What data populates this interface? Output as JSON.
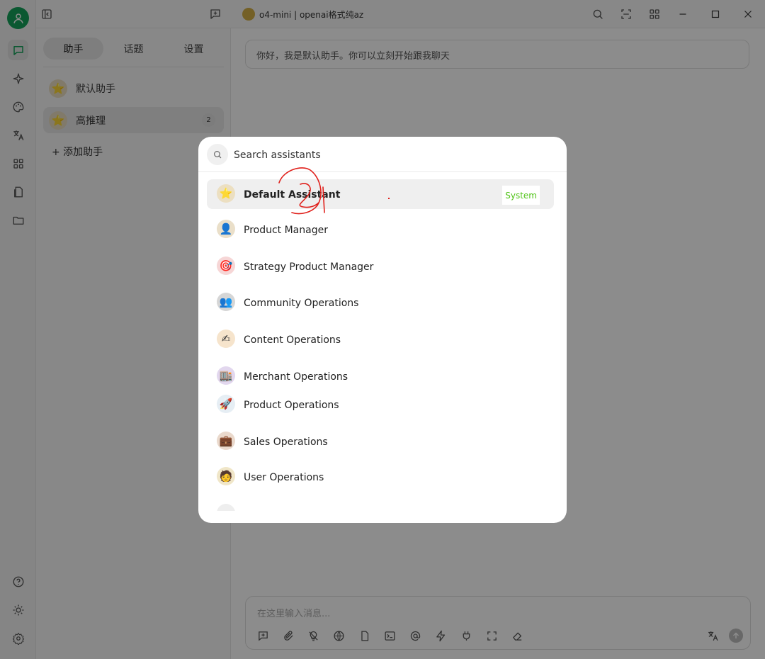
{
  "header": {
    "model_title": "o4-mini | openai格式纯az"
  },
  "sidebar": {
    "tabs": [
      {
        "label": "助手",
        "active": true
      },
      {
        "label": "话题",
        "active": false
      },
      {
        "label": "设置",
        "active": false
      }
    ],
    "assistants": [
      {
        "label": "默认助手",
        "icon": "star-icon"
      },
      {
        "label": "高推理",
        "icon": "star-icon",
        "count": "2",
        "active": true
      }
    ],
    "add_label": "+ 添加助手"
  },
  "chat": {
    "greeting": "你好，我是默认助手。你可以立刻开始跟我聊天",
    "input_placeholder": "在这里输入消息..."
  },
  "modal": {
    "search_placeholder": "Search assistants",
    "items": [
      {
        "name": "Default Assistant",
        "icon": "star-icon",
        "tag": "System",
        "selected": true
      },
      {
        "name": "Product Manager",
        "icon": "person-icon"
      },
      {
        "name": "Strategy Product Manager",
        "icon": "target-icon"
      },
      {
        "name": "Community Operations",
        "icon": "people-icon"
      },
      {
        "name": "Content Operations",
        "icon": "writing-icon"
      },
      {
        "name": "Merchant Operations",
        "icon": "shop-icon"
      },
      {
        "name": "Product Operations",
        "icon": "rocket-icon"
      },
      {
        "name": "Sales Operations",
        "icon": "briefcase-icon"
      },
      {
        "name": "User Operations",
        "icon": "users-icon"
      }
    ]
  },
  "colors": {
    "avatar_green": "#15a15a",
    "system_tag": "#52c41a",
    "annotation_red": "#e0201b"
  }
}
